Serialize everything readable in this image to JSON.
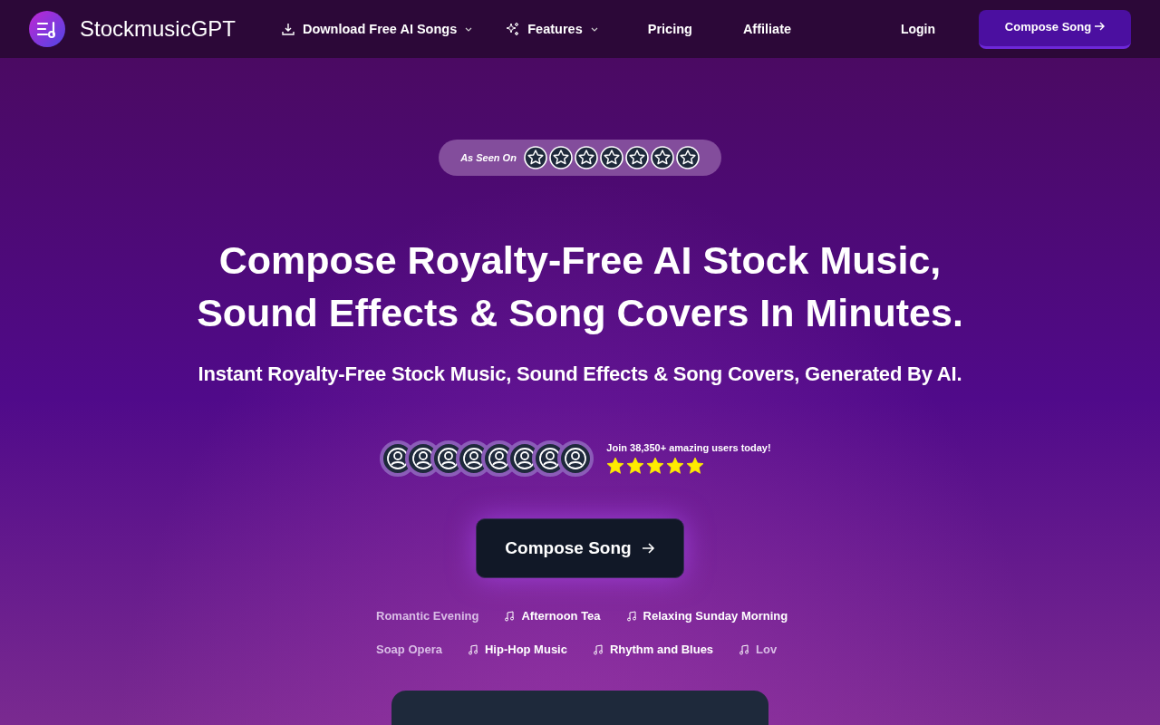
{
  "nav": {
    "brand": "StockmusicGPT",
    "items": [
      {
        "label": "Download Free AI Songs",
        "kind": "download",
        "dropdown": true
      },
      {
        "label": "Features",
        "kind": "sparkle",
        "dropdown": true
      },
      {
        "label": "Pricing",
        "kind": "plain",
        "dropdown": false
      },
      {
        "label": "Affiliate",
        "kind": "plain",
        "dropdown": false
      }
    ],
    "login": "Login",
    "cta": "Compose Song"
  },
  "seen_on": {
    "label": "As Seen On"
  },
  "hero": {
    "title_lines": [
      "Compose Royalty-Free AI Stock Music,",
      "Sound Effects & Song Covers In Minutes."
    ],
    "subtitle": "Instant Royalty-Free Stock Music, Sound Effects & Song Covers, Generated By AI."
  },
  "social_proof": {
    "text": "Join 38,350+ amazing users today!",
    "stars": 5
  },
  "cta": "Compose Song",
  "tag_rows": [
    [
      {
        "label": "Romantic Evening",
        "icon": false
      },
      {
        "label": "Afternoon Tea",
        "icon": true
      },
      {
        "label": "Relaxing Sunday Morning",
        "icon": true
      }
    ],
    [
      {
        "label": "Soap Opera",
        "icon": false
      },
      {
        "label": "Hip-Hop Music",
        "icon": true
      },
      {
        "label": "Rhythm and Blues",
        "icon": true
      },
      {
        "label": "Lov",
        "icon": true
      }
    ]
  ]
}
